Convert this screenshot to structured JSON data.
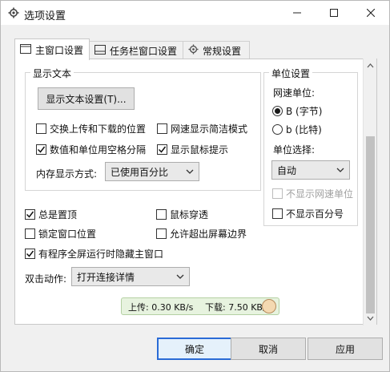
{
  "window": {
    "title": "选项设置",
    "icon": "gear-icon"
  },
  "tabs": [
    {
      "label": "主窗口设置",
      "icon": "window-icon",
      "active": true
    },
    {
      "label": "任务栏窗口设置",
      "icon": "taskbar-icon",
      "active": false
    },
    {
      "label": "常规设置",
      "icon": "gear-icon",
      "active": false
    }
  ],
  "display_text": {
    "group_title": "显示文本",
    "settings_button": "显示文本设置(T)...",
    "swap_updown": {
      "label": "交换上传和下载的位置",
      "checked": false
    },
    "simple_mode": {
      "label": "网速显示简洁模式",
      "checked": false
    },
    "space_separate": {
      "label": "数值和单位用空格分隔",
      "checked": true
    },
    "show_tooltip": {
      "label": "显示鼠标提示",
      "checked": true
    },
    "memory_label": "内存显示方式:",
    "memory_value": "已使用百分比"
  },
  "unit_settings": {
    "group_title": "单位设置",
    "speed_unit_label": "网速单位:",
    "radio_B": {
      "label": "B (字节)",
      "selected": true
    },
    "radio_b": {
      "label": "b (比特)",
      "selected": false
    },
    "unit_select_label": "单位选择:",
    "unit_select_value": "自动",
    "hide_speed_unit": {
      "label": "不显示网速单位",
      "checked": false,
      "disabled": true
    },
    "hide_percent": {
      "label": "不显示百分号",
      "checked": false
    }
  },
  "general": {
    "always_on_top": {
      "label": "总是置顶",
      "checked": true
    },
    "mouse_through": {
      "label": "鼠标穿透",
      "checked": false
    },
    "lock_position": {
      "label": "锁定窗口位置",
      "checked": false
    },
    "allow_offscreen": {
      "label": "允许超出屏幕边界",
      "checked": false
    },
    "hide_fullscreen": {
      "label": "有程序全屏运行时隐藏主窗口",
      "checked": true
    },
    "double_click_label": "双击动作:",
    "double_click_value": "打开连接详情"
  },
  "status_preview": {
    "upload": "上传: 0.30 KB/s",
    "download": "下载: 7.50 KB/s"
  },
  "buttons": {
    "ok": "确定",
    "cancel": "取消",
    "apply": "应用"
  },
  "colors": {
    "accent": "#2a6bd6",
    "status_bg": "#e7f3df"
  }
}
